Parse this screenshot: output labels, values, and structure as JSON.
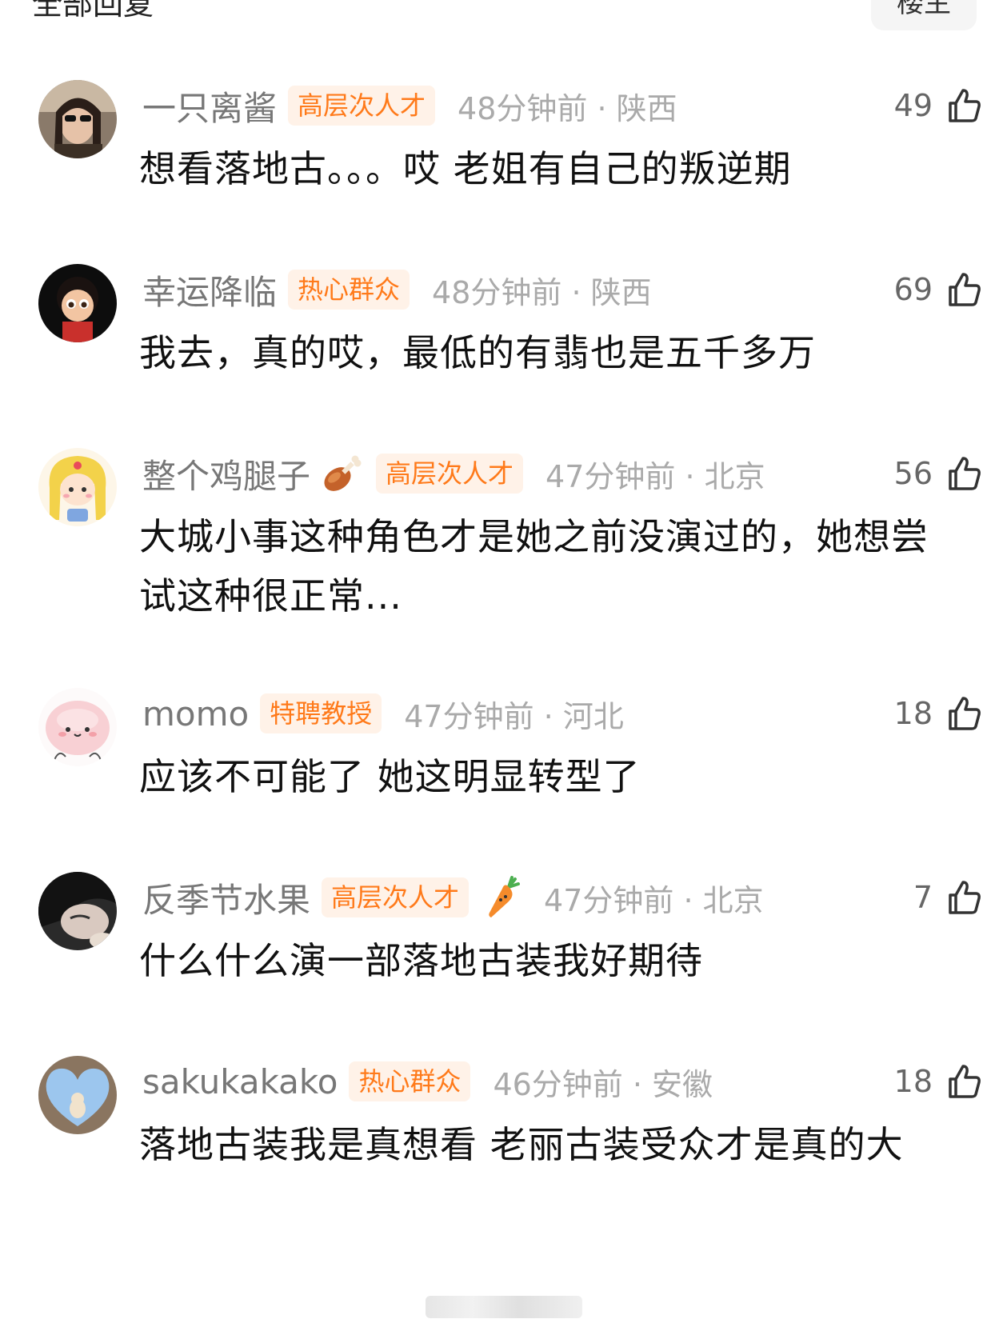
{
  "header": {
    "title": "全部回复",
    "sort_label": "楼主"
  },
  "comments": [
    {
      "username": "一只离酱",
      "badge": "高层次人才",
      "time_location": "48分钟前 · 陕西",
      "likes": "49",
      "text": "想看落地古。。。哎 老姐有自己的叛逆期",
      "avatar_icon": "avatar-photo-woman-sunglasses-icon"
    },
    {
      "username": "幸运降临",
      "badge": "热心群众",
      "time_location": "48分钟前 · 陕西",
      "likes": "69",
      "text": "我去，真的哎，最低的有翡也是五千多万",
      "avatar_icon": "avatar-cartoon-girl-icon"
    },
    {
      "username": "整个鸡腿子",
      "badge": "高层次人才",
      "time_location": "47分钟前 · 北京",
      "likes": "56",
      "text": "大城小事这种角色才是她之前没演过的，她想尝试这种很正常...",
      "avatar_icon": "avatar-anime-blonde-icon",
      "name_emoji": "drumstick-icon"
    },
    {
      "username": "momo",
      "badge": "特聘教授",
      "time_location": "47分钟前 · 河北",
      "likes": "18",
      "text": "应该不可能了 她这明显转型了",
      "avatar_icon": "avatar-pink-blob-icon"
    },
    {
      "username": "反季节水果",
      "badge": "高层次人才",
      "time_location": "47分钟前 · 北京",
      "likes": "7",
      "text": "什么什么演一部落地古装我好期待",
      "avatar_icon": "avatar-photo-dark-hair-icon",
      "badge_emoji": "carrot-icon"
    },
    {
      "username": "sakukakako",
      "badge": "热心群众",
      "time_location": "46分钟前 · 安徽",
      "likes": "18",
      "text": "落地古装我是真想看 老丽古装受众才是真的大",
      "avatar_icon": "avatar-heart-sky-icon"
    }
  ],
  "colors": {
    "badge_bg": "#fff2e8",
    "badge_text": "#ff7a1a",
    "meta_gray": "#aaaaaa",
    "name_gray": "#777777"
  }
}
